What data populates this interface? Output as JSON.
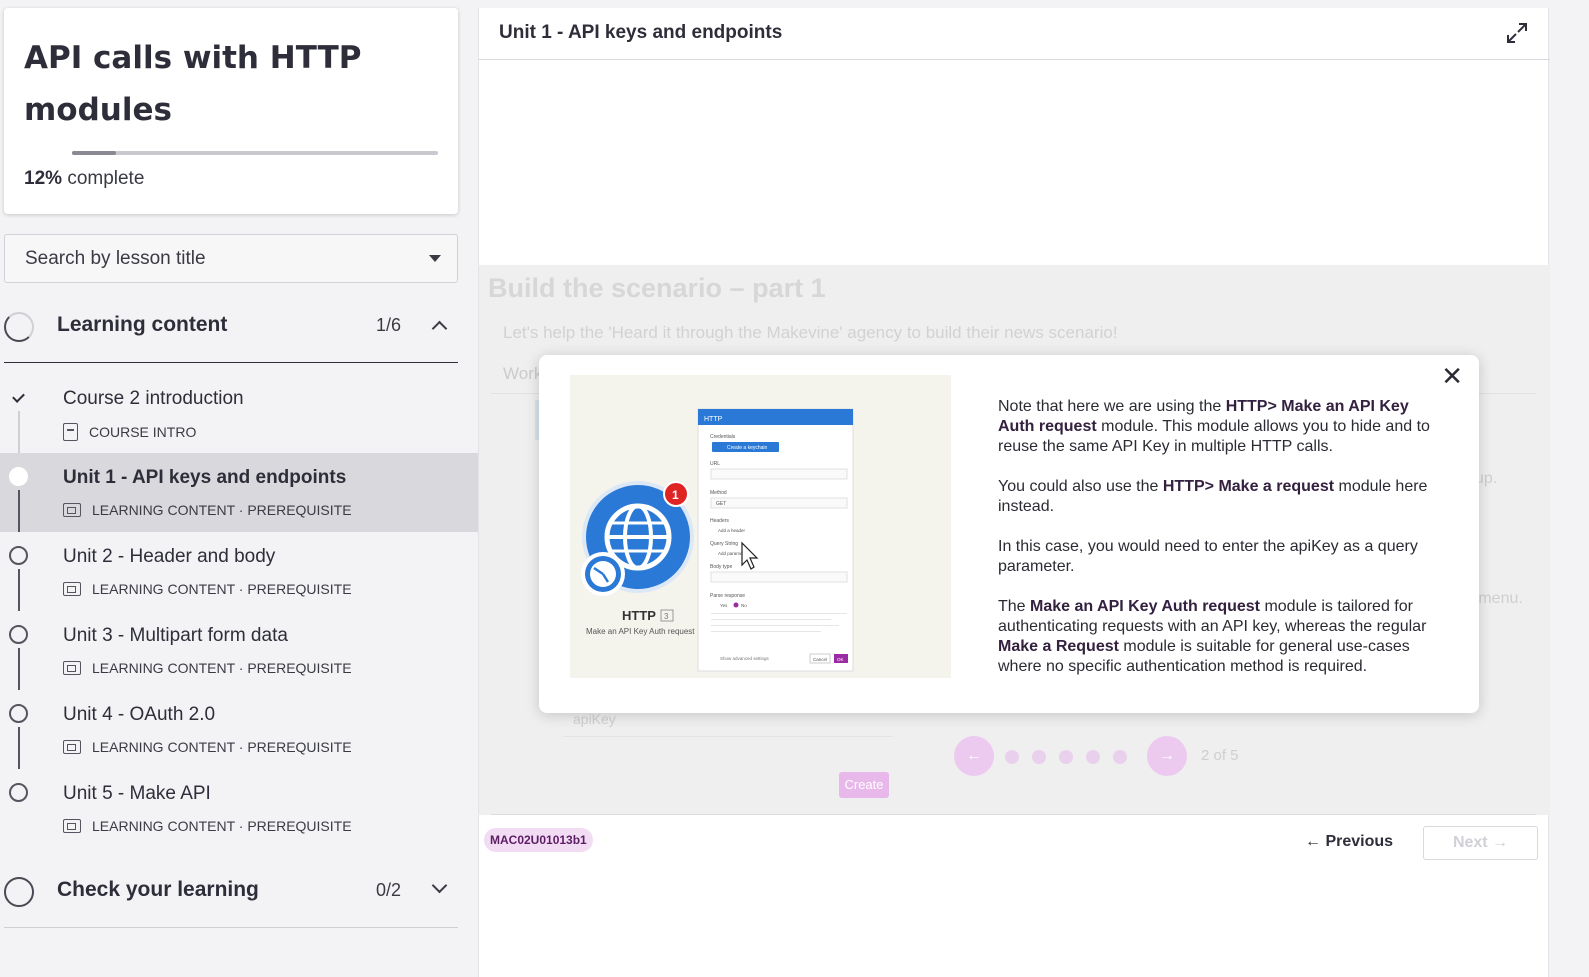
{
  "course": {
    "title": "API calls with HTTP modules",
    "progress_percent": "12%",
    "progress_fraction": 0.12,
    "progress_suffix": "complete"
  },
  "search": {
    "placeholder": "Search by lesson title"
  },
  "sections": [
    {
      "title": "Learning content",
      "count": "1/6",
      "expanded": true
    },
    {
      "title": "Check your learning",
      "count": "0/2",
      "expanded": false
    }
  ],
  "lessons": [
    {
      "title": "Course 2 introduction",
      "meta": "COURSE INTRO",
      "status": "completed",
      "icon": "document-icon"
    },
    {
      "title": "Unit 1 - API keys and endpoints",
      "meta": "LEARNING CONTENT · PREREQUISITE",
      "status": "active",
      "icon": "slides-icon"
    },
    {
      "title": "Unit 2 - Header and body",
      "meta": "LEARNING CONTENT · PREREQUISITE",
      "status": "not-started",
      "icon": "slides-icon"
    },
    {
      "title": "Unit 3 - Multipart form data",
      "meta": "LEARNING CONTENT · PREREQUISITE",
      "status": "not-started",
      "icon": "slides-icon"
    },
    {
      "title": "Unit 4 - OAuth 2.0",
      "meta": "LEARNING CONTENT · PREREQUISITE",
      "status": "not-started",
      "icon": "slides-icon"
    },
    {
      "title": "Unit 5 - Make API",
      "meta": "LEARNING CONTENT · PREREQUISITE",
      "status": "not-started",
      "icon": "slides-icon"
    }
  ],
  "main": {
    "title": "Unit 1 - API keys and endpoints",
    "background": {
      "heading": "Build the scenario – part 1",
      "subtitle": "Let's help the 'Heard it through the Makevine' agency to build their news scenario!",
      "work_label": "Work",
      "side_text_1": "up.",
      "side_text_2": "n menu.",
      "input_placeholder": "apiKey",
      "create_label": "Create",
      "pager": "2 of 5"
    },
    "modal": {
      "p1_a": "Note that here we are using the ",
      "p1_b": "HTTP> Make an API Key Auth request",
      "p1_c": " module. This module allows you to hide and to reuse the same API Key in multiple HTTP calls.",
      "p2_a": "You could also use the ",
      "p2_b": "HTTP> Make a request",
      "p2_c": " module here instead.",
      "p3": "In this case, you would need to enter the apiKey as a query parameter.",
      "p4_a": "The ",
      "p4_b": "Make an API Key Auth request",
      "p4_c": " module is tailored for authenticating requests with an API key, whereas the regular ",
      "p4_d": "Make a Request",
      "p4_e": " module is suitable for general use-cases where no specific authentication method is required.",
      "image": {
        "module_name": "HTTP",
        "module_number": "3",
        "module_caption": "Make an API Key Auth request",
        "badge": "1",
        "panel_title": "HTTP",
        "credentials_label": "Credentials",
        "keychain_button": "Create a keychain",
        "url_label": "URL",
        "method_label": "Method",
        "method_value": "GET",
        "headers_label": "Headers",
        "add_header": "Add a header",
        "query_label": "Query String",
        "add_param": "Add parameter",
        "body_label": "Body type",
        "parse_label": "Parse response",
        "yes": "Yes",
        "no": "No",
        "adv": "Show advanced settings",
        "cancel": "Cancel",
        "ok": "OK"
      }
    },
    "code_badge": "MAC02U01013b1",
    "previous_label": "← Previous",
    "next_label": "Next →"
  },
  "colors": {
    "accent": "#9b2ca4",
    "badge_bg": "#f2dcf4",
    "http_blue": "#2a79d6",
    "notification_red": "#e02424"
  }
}
